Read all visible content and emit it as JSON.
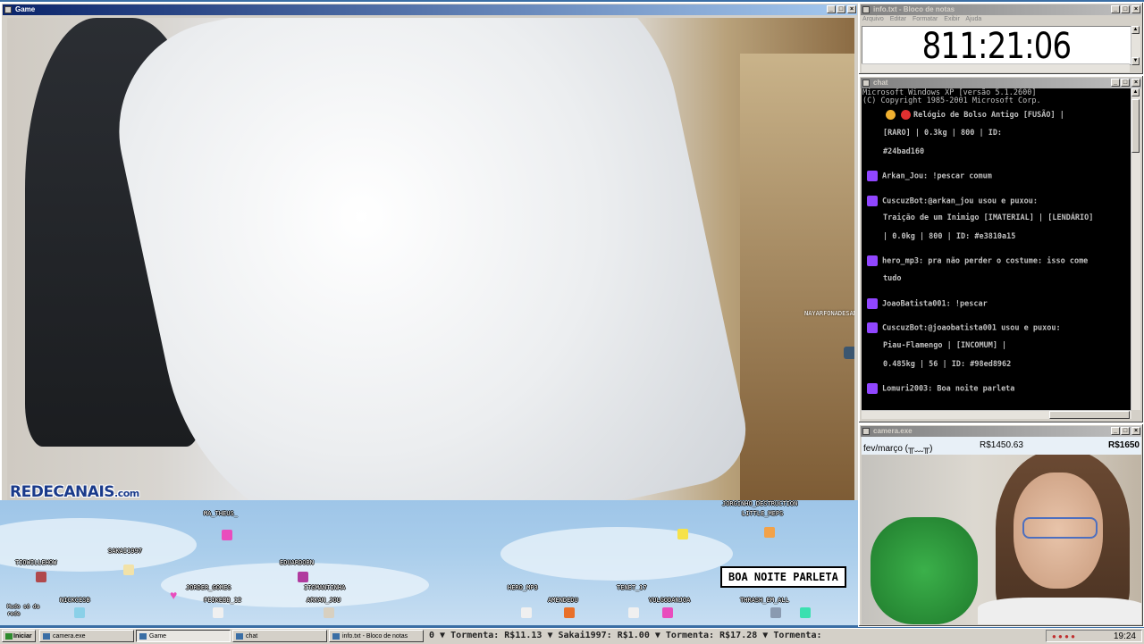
{
  "windows": {
    "game": {
      "title": "Game"
    },
    "info": {
      "title": "info.txt - Bloco de notas",
      "menu": [
        "Arquivo",
        "Editar",
        "Formatar",
        "Exibir",
        "Ajuda"
      ],
      "content": "811:21:06"
    },
    "chat": {
      "title": "chat"
    },
    "camera": {
      "title": "camera.exe"
    }
  },
  "game_overlay": {
    "watermark": "REDECANAIS",
    "watermark_domain": ".com",
    "floating_name": "NAYARFONADESAMMER"
  },
  "chat": {
    "header": [
      "Microsoft Windows XP [versão 5.1.2600]",
      "(C) Copyright 1985-2001 Microsoft Corp."
    ],
    "messages": [
      {
        "user": "",
        "lines": [
          "Relógio de Bolso Antigo [FUSÃO] |",
          "[RARO] | 0.3kg | 800 | ID:",
          "#24bad160"
        ]
      },
      {
        "user": "Arkan_Jou:",
        "lines": [
          "!pescar comum"
        ]
      },
      {
        "user": "CuscuzBot:",
        "lines": [
          "@arkan_jou usou e puxou:",
          "Traição de um Inimigo [IMATERIAL] | [LENDÁRIO]",
          "| 0.0kg | 800 | ID: #e3810a15"
        ]
      },
      {
        "user": "hero_mp3:",
        "lines": [
          "pra não perder o costume: isso come",
          "tudo"
        ]
      },
      {
        "user": "JoaoBatista001:",
        "lines": [
          "!pescar"
        ]
      },
      {
        "user": "CuscuzBot:",
        "lines": [
          "@joaobatista001 usou e puxou:",
          "Piau-Flamengo | [INCOMUM] |",
          "0.485kg | 56 | ID: #98ed8962"
        ]
      },
      {
        "user": "Lomuri2003:",
        "lines": [
          "Boa noite parleta"
        ]
      }
    ]
  },
  "camera": {
    "bar_label": "fev/março (╥﹏╥)",
    "amount": "R$1450.63",
    "goal": "R$1650"
  },
  "stage": {
    "bubble": "BOA NOITE PARLETA",
    "names": [
      "MA_THEUS_",
      "SAKAI1997",
      "TIOWILLEHOW",
      "EDUARDOBN",
      "JORDER_GOMES",
      "ITSMANTINHA",
      "FEIKEBB_12",
      "ARKAN_JOU",
      "NICKCESB",
      "HERO_MP3",
      "AMENDEDU",
      "TENET_17",
      "VULGODANJOA",
      "JORGINHO_DESTRUCTION",
      "LITTLE_MEPS",
      "THRASH_EM_ALL"
    ],
    "corner_label": "Mudo só da rede"
  },
  "taskbar": {
    "start": "Iniciar",
    "tasks": [
      "camera.exe",
      "Game",
      "chat",
      "info.txt - Bloco de notas"
    ],
    "ticker": "0 ▼ Tormenta: R$11.13 ▼ Sakai1997: R$1.00 ▼ Tormenta: R$17.28 ▼ Tormenta:",
    "clock": "19:24"
  },
  "colors": {
    "titlebar_active": "#0a246a",
    "twitch_purple": "#9146ff",
    "chat_bg": "#000000"
  }
}
